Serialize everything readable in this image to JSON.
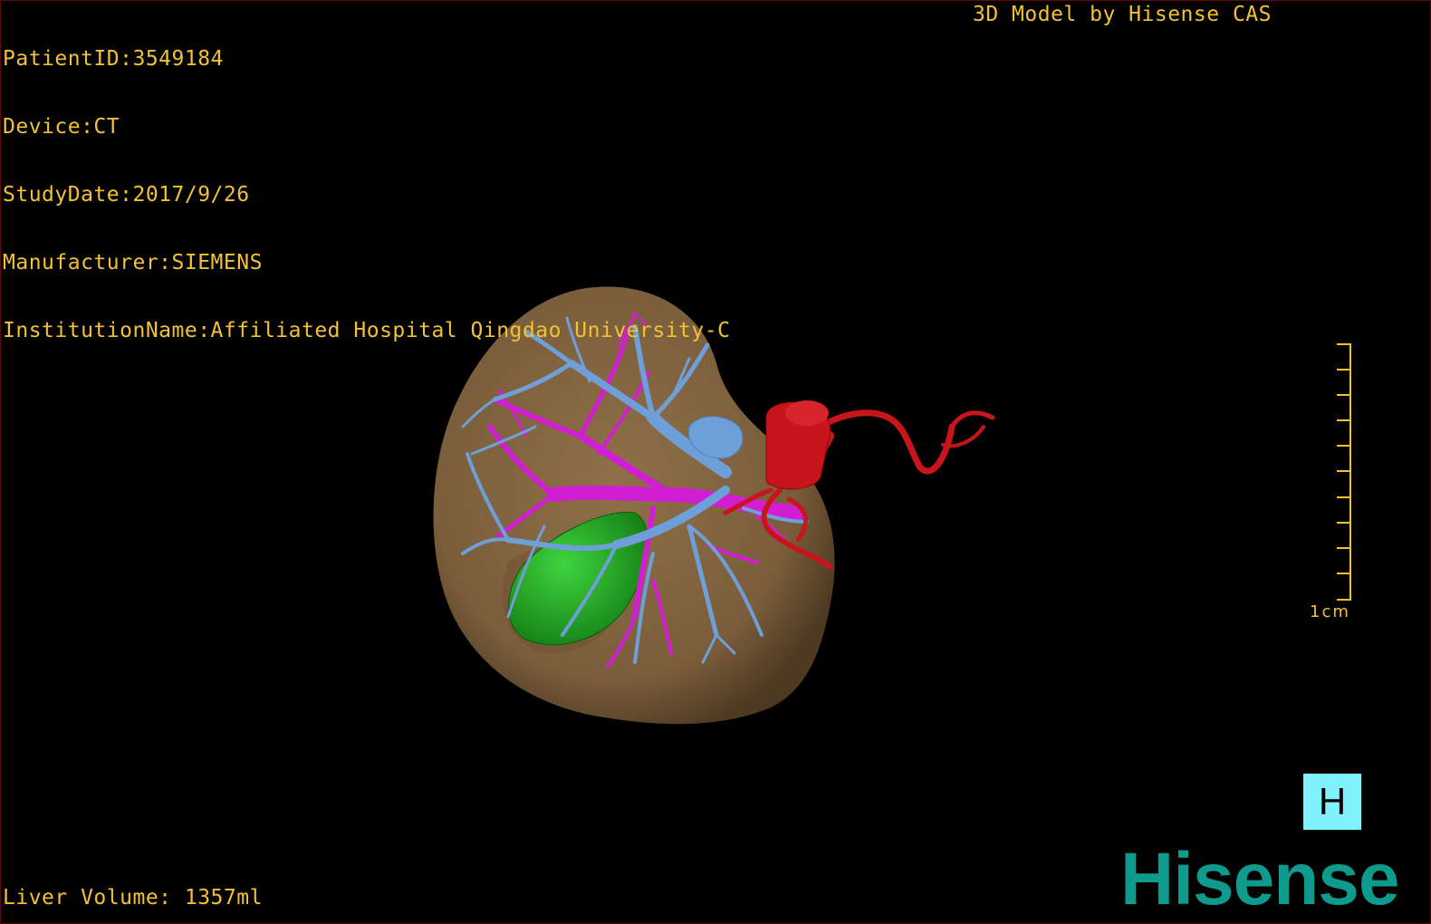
{
  "info": {
    "patient_id": "PatientID:3549184",
    "device": "Device:CT",
    "study_date": "StudyDate:2017/9/26",
    "manufacturer": "Manufacturer:SIEMENS",
    "institution": "InstitutionName:Affiliated Hospital Qingdao University-C"
  },
  "header": {
    "model_label": "3D Model by Hisense CAS"
  },
  "footer": {
    "liver_volume": "Liver Volume: 1357ml"
  },
  "scale": {
    "label": "1cm"
  },
  "view_button": {
    "label": "H"
  },
  "brand": {
    "logo": "Hisense"
  },
  "colors": {
    "overlay_text": "#f2c233",
    "liver": "#8a6a45",
    "hepatic_vein": "#6f9fd8",
    "portal_vein": "#d21ed2",
    "artery": "#c8141b",
    "gallbladder": "#1fa81f",
    "view_button": "#7ff2fb",
    "brand": "#0f9a8e"
  }
}
